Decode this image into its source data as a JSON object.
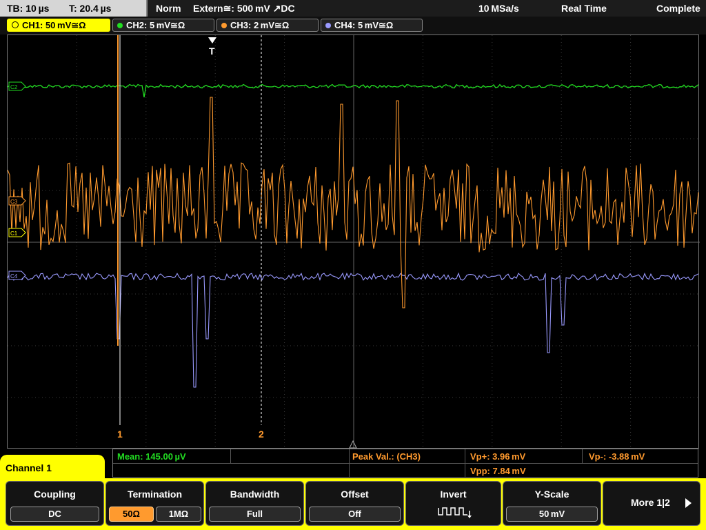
{
  "status": {
    "timebase": "TB: 10 µs",
    "trigger_pos": "T: 20.4 µs",
    "mode": "Norm",
    "trigger_src": "Extern≅: 500 mV ↗DC",
    "sample_rate": "10 MSa/s",
    "acq_mode": "Real Time",
    "acq_state": "Complete"
  },
  "channels": [
    {
      "label": "CH1: 50 mV≅Ω",
      "color": "#ffff00",
      "active": true
    },
    {
      "label": "CH2: 5 mV≅Ω",
      "color": "#22dd22",
      "active": false
    },
    {
      "label": "CH3: 2 mV≅Ω",
      "color": "#ff9a2e",
      "active": false
    },
    {
      "label": "CH4: 5 mV≅Ω",
      "color": "#9a9aff",
      "active": false
    }
  ],
  "markers": {
    "trigger": "T",
    "cursor1": "1",
    "cursor2": "2",
    "ch2": "C2",
    "ch3": "C3",
    "ch1": "C1",
    "ch4": "C4"
  },
  "measurement": {
    "mean": "Mean: 145.00 µV",
    "peak_label": "Peak Val.:  (CH3)",
    "vp_plus": "Vp+: 3.96 mV",
    "vp_minus": "Vp-: -3.88 mV",
    "vpp": "Vpp: 7.84 mV"
  },
  "menu": {
    "channel_title": "Channel 1",
    "coupling": {
      "title": "Coupling",
      "value": "DC"
    },
    "termination": {
      "title": "Termination",
      "options": [
        "50Ω",
        "1MΩ"
      ],
      "selected": "50Ω"
    },
    "bandwidth": {
      "title": "Bandwidth",
      "value": "Full"
    },
    "offset": {
      "title": "Offset",
      "value": "Off"
    },
    "invert": {
      "title": "Invert"
    },
    "yscale": {
      "title": "Y-Scale",
      "value": "50 mV"
    },
    "more": "More 1|2"
  },
  "colors": {
    "ch1": "#ffff00",
    "ch2": "#22dd22",
    "ch3": "#ff9a2e",
    "ch4": "#9a9aff",
    "grid": "#4a4a4a",
    "measurement_mean": "#22dd22",
    "measurement_peak": "#ff9a2e"
  }
}
